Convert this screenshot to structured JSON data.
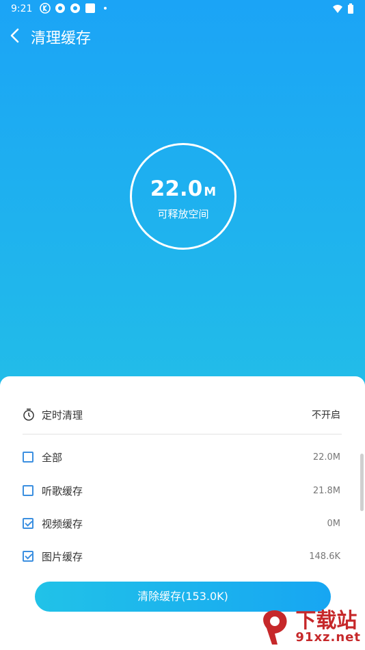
{
  "status": {
    "time": "9:21"
  },
  "header": {
    "title": "清理缓存"
  },
  "summary": {
    "value": "22.0",
    "unit": "M",
    "label": "可释放空间"
  },
  "timer": {
    "label": "定时清理",
    "value": "不开启"
  },
  "items": [
    {
      "label": "全部",
      "size": "22.0M",
      "checked": false
    },
    {
      "label": "听歌缓存",
      "size": "21.8M",
      "checked": false
    },
    {
      "label": "视频缓存",
      "size": "0M",
      "checked": true
    },
    {
      "label": "图片缓存",
      "size": "148.6K",
      "checked": true
    }
  ],
  "action": {
    "label": "清除缓存(153.0K)"
  },
  "watermark": {
    "title": "下载站",
    "url": "91xz.net"
  },
  "colors": {
    "gradient_top": "#1ba4f6",
    "gradient_bottom": "#22bde8",
    "accent": "#3b8fe0",
    "watermark": "#c6282a"
  }
}
